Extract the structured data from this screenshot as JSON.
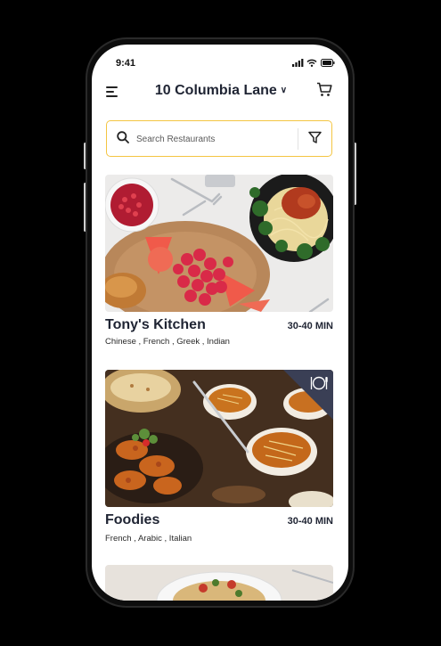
{
  "status_bar": {
    "time": "9:41"
  },
  "header": {
    "address": "10 Columbia Lane"
  },
  "search": {
    "placeholder": "Search Restaurants",
    "value": ""
  },
  "restaurants": [
    {
      "name": "Tony's Kitchen",
      "time": "30-40 MIN",
      "cuisines": "Chinese , French , Greek , Indian"
    },
    {
      "name": "Foodies",
      "time": "30-40 MIN",
      "cuisines": "French , Arabic , Italian"
    }
  ],
  "colors": {
    "accent": "#f4c542",
    "text_dark": "#1f2433",
    "badge": "#3a3f55"
  },
  "icons": [
    "menu-icon",
    "chevron-down-icon",
    "cart-icon",
    "search-icon",
    "filter-icon",
    "dining-icon",
    "signal-icon",
    "wifi-icon",
    "battery-icon"
  ]
}
